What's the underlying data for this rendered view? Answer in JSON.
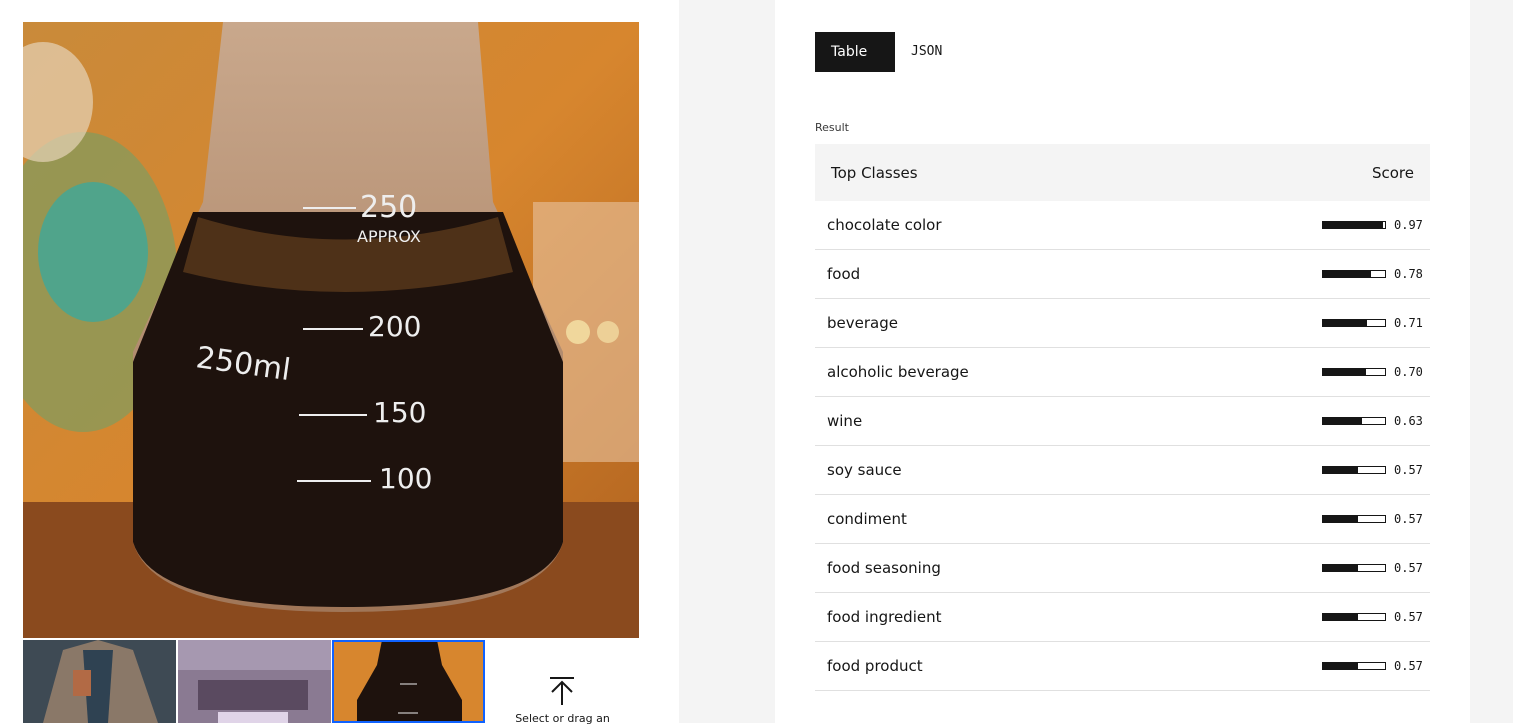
{
  "tabs": {
    "table": "Table",
    "json": "JSON"
  },
  "result_label": "Result",
  "table": {
    "header_class": "Top Classes",
    "header_score": "Score",
    "rows": [
      {
        "label": "chocolate color",
        "score": "0.97",
        "value": 0.97
      },
      {
        "label": "food",
        "score": "0.78",
        "value": 0.78
      },
      {
        "label": "beverage",
        "score": "0.71",
        "value": 0.71
      },
      {
        "label": "alcoholic beverage",
        "score": "0.70",
        "value": 0.7
      },
      {
        "label": "wine",
        "score": "0.63",
        "value": 0.63
      },
      {
        "label": "soy sauce",
        "score": "0.57",
        "value": 0.57
      },
      {
        "label": "condiment",
        "score": "0.57",
        "value": 0.57
      },
      {
        "label": "food seasoning",
        "score": "0.57",
        "value": 0.57
      },
      {
        "label": "food ingredient",
        "score": "0.57",
        "value": 0.57
      },
      {
        "label": "food product",
        "score": "0.57",
        "value": 0.57
      }
    ]
  },
  "image": {
    "flask_marks": [
      "250",
      "APPROX",
      "200",
      "150",
      "100",
      "250ml"
    ]
  },
  "upload": {
    "text": "Select or drag an"
  },
  "colors": {
    "accent": "#0f62fe",
    "dark": "#161616",
    "gutter": "#f4f4f4"
  }
}
